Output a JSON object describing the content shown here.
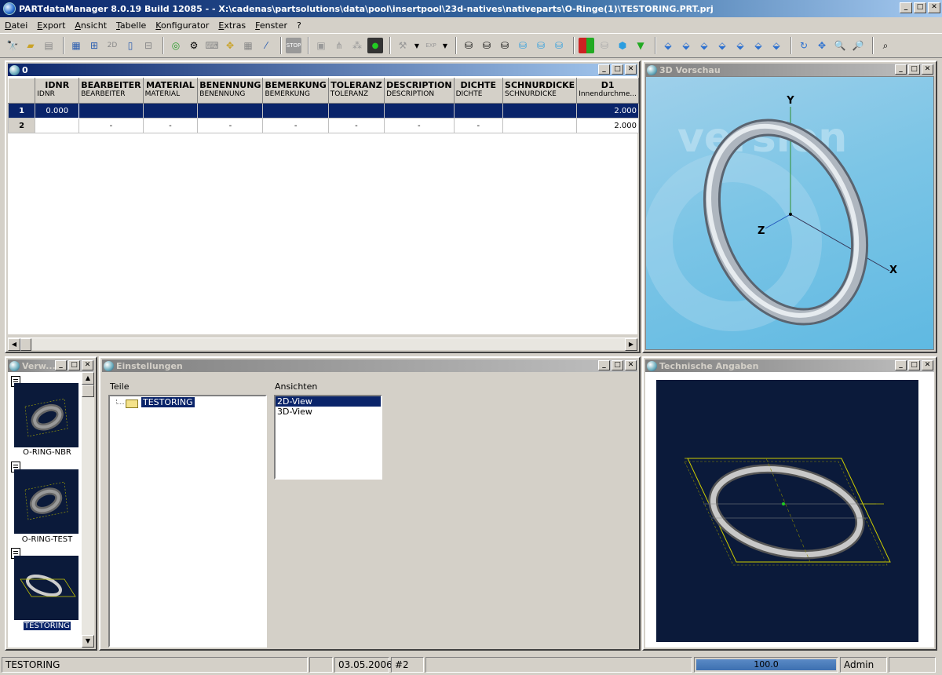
{
  "window": {
    "title": "PARTdataManager 8.0.19 Build 12085 -  - X:\\cadenas\\partsolutions\\data\\pool\\insertpool\\23d-natives\\nativeparts\\O-Ringe(1)\\TESTORING.PRT.prj"
  },
  "menu": [
    "Datei",
    "Export",
    "Ansicht",
    "Tabelle",
    "Konfigurator",
    "Extras",
    "Fenster",
    "?"
  ],
  "toolbar": {
    "icons": [
      "binoculars-icon",
      "open-folder-icon",
      "print-icon",
      "table-layout-icon",
      "grid-icon",
      "2d-icon",
      "doc-icon",
      "tree-icon",
      "globe-icon",
      "gear-icon",
      "keyboard-icon",
      "move-icon",
      "table-icon",
      "wand-icon",
      "stop-icon",
      "bom-icon",
      "filter-icon",
      "nodes-icon",
      "traffic-light-icon",
      "tools-icon",
      "exp-icon",
      "cylinder-icon",
      "cube-red-green-icon",
      "cube-blue-icon",
      "arrow-down-icon",
      "view-iso-icon",
      "rotate-icon",
      "pan-icon",
      "zoom-icon",
      "zoom-window-icon",
      "measure-icon"
    ]
  },
  "table_panel": {
    "title": "0",
    "columns": [
      {
        "name": "IDNR",
        "sub": "IDNR"
      },
      {
        "name": "BEARBEITER",
        "sub": "BEARBEITER"
      },
      {
        "name": "MATERIAL",
        "sub": "MATERIAL"
      },
      {
        "name": "BENENNUNG",
        "sub": "BENENNUNG"
      },
      {
        "name": "BEMERKUNG",
        "sub": "BEMERKUNG"
      },
      {
        "name": "TOLERANZ",
        "sub": "TOLERANZ"
      },
      {
        "name": "DESCRIPTION",
        "sub": "DESCRIPTION"
      },
      {
        "name": "DICHTE",
        "sub": "DICHTE"
      },
      {
        "name": "SCHNURDICKE",
        "sub": "SCHNURDICKE"
      },
      {
        "name": "D1",
        "sub": "Innendurchme..."
      }
    ],
    "rows": [
      {
        "num": "1",
        "cells": [
          "0.000",
          "",
          "",
          "",
          "",
          "",
          "",
          "",
          "",
          "2.000"
        ]
      },
      {
        "num": "2",
        "cells": [
          "",
          "-",
          "-",
          "-",
          "-",
          "-",
          "-",
          "-",
          "",
          "2.000"
        ]
      }
    ]
  },
  "preview_panel": {
    "title": "3D Vorschau",
    "axes": {
      "y": "Y",
      "z": "Z",
      "x": "X"
    },
    "watermark": "version"
  },
  "list_panel": {
    "title": "Verw...",
    "items": [
      {
        "label": "O-RING-NBR",
        "selected": false
      },
      {
        "label": "O-RING-TEST",
        "selected": false
      },
      {
        "label": "TESTORING",
        "selected": true
      }
    ]
  },
  "settings_panel": {
    "title": "Einstellungen",
    "parts_label": "Teile",
    "parts": [
      "TESTORING"
    ],
    "views_label": "Ansichten",
    "views": [
      {
        "label": "2D-View",
        "selected": true
      },
      {
        "label": "3D-View",
        "selected": false
      }
    ]
  },
  "tech_panel": {
    "title": "Technische Angaben"
  },
  "status": {
    "part": "TESTORING",
    "date": "03.05.2006",
    "count": "#2",
    "progress": "100.0",
    "progress_fraction": 1.0,
    "user": "Admin"
  },
  "colors": {
    "accent": "#0a246a",
    "face": "#d4d0c8",
    "preview_bg": "#7cc5e6",
    "tech_bg": "#0b1a3a"
  }
}
